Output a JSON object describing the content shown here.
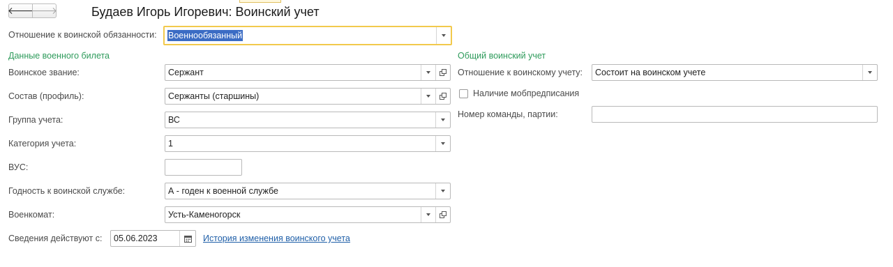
{
  "nav": {
    "back_glyph": "🡐",
    "forward_glyph": "🡒"
  },
  "title": "Будаев Игорь Игоревич: Воинский учет",
  "relation": {
    "label": "Отношение к воинской обязанности:",
    "value": "Военнообязанный"
  },
  "military_id": {
    "heading": "Данные военного билета",
    "rank": {
      "label": "Воинское звание:",
      "value": "Сержант"
    },
    "composition": {
      "label": "Состав (профиль):",
      "value": "Сержанты (старшины)"
    },
    "group": {
      "label": "Группа учета:",
      "value": "ВС"
    },
    "category": {
      "label": "Категория учета:",
      "value": "1"
    },
    "vus": {
      "label": "ВУС:",
      "value": ""
    },
    "fitness": {
      "label": "Годность к воинской службе:",
      "value": "А - годен к военной службе"
    },
    "office": {
      "label": "Военкомат:",
      "value": "Усть-Каменогорск"
    },
    "valid_from": {
      "label": "Сведения действуют с:",
      "value": "05.06.2023"
    },
    "history_link": "История изменения воинского учета"
  },
  "general": {
    "heading": "Общий воинский учет",
    "relation": {
      "label": "Отношение к воинскому учету:",
      "value": "Состоит на воинском учете"
    },
    "mob_order": {
      "label": "Наличие мобпредписания",
      "checked": false
    },
    "team_number": {
      "label": "Номер команды, партии:",
      "value": ""
    }
  },
  "icons": {
    "dropdown": "chevron-down-icon",
    "open": "open-form-icon",
    "calendar": "calendar-icon"
  }
}
